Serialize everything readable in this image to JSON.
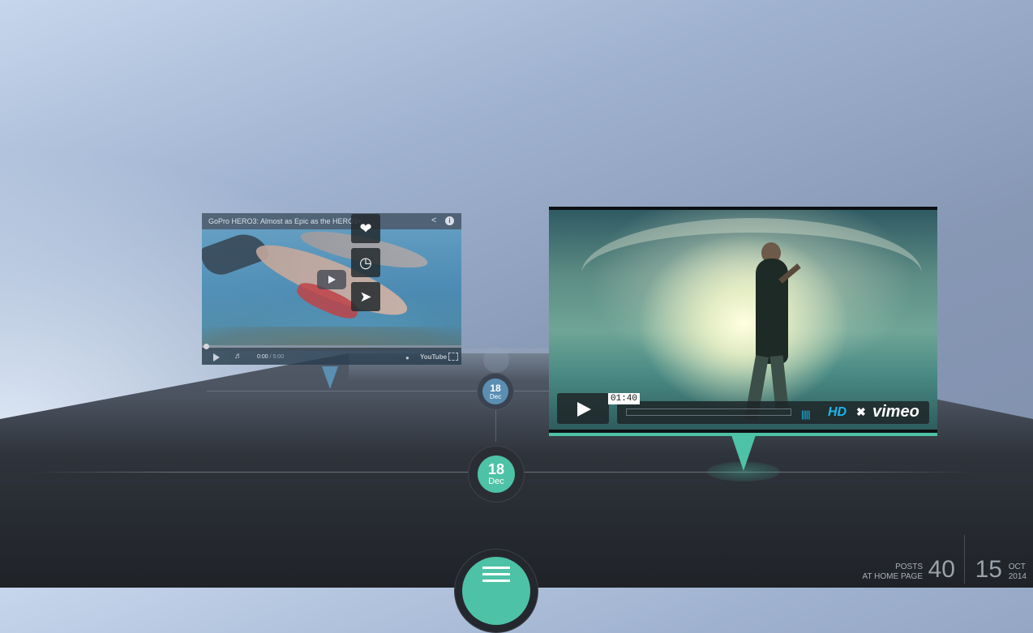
{
  "timeline": {
    "front_date": {
      "day": "18",
      "month": "Dec"
    },
    "back_date": {
      "day": "18",
      "month": "Dec"
    }
  },
  "youtube_card": {
    "title": "GoPro HERO3: Almost as Epic as the HERO3+",
    "time_current": "0:00",
    "time_total": "5:00",
    "logo_text": "YouTube",
    "share_icon": "share-icon",
    "info_icon": "info-icon"
  },
  "vimeo_card": {
    "time_tooltip": "01:40",
    "hd_label": "HD",
    "logo_text": "vimeo",
    "icons": [
      "heart-icon",
      "clock-icon",
      "send-icon"
    ]
  },
  "colors": {
    "accent": "#4ec2a6",
    "back_accent": "#5a8fb2",
    "vimeo_blue": "#19b7ea"
  },
  "stats": {
    "posts_label_1": "POSTS",
    "posts_label_2": "AT HOME PAGE",
    "posts_count": "40",
    "day": "15",
    "month": "OCT",
    "year": "2014"
  }
}
